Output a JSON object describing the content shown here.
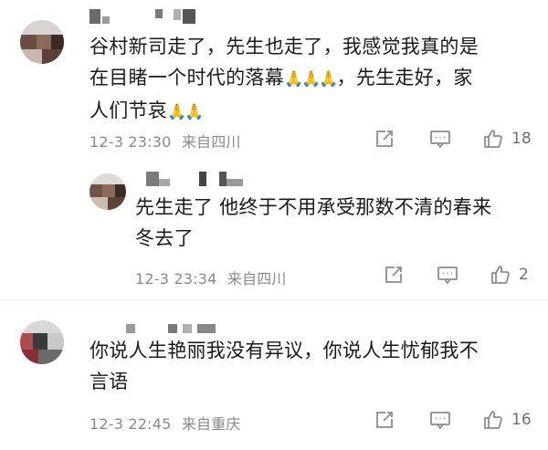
{
  "comments": [
    {
      "text_lines": [
        "谷村新司走了，先生也走了，我感觉我真的是",
        "在目睹一个时代的落幕",
        "，先生走好，家",
        "人们节哀"
      ],
      "emoji_mid": "🙏🙏🙏",
      "emoji_end": "🙏🙏",
      "timestamp": "12-3 23:30",
      "location": "来自四川",
      "like_count": "18"
    },
    {
      "text_lines": [
        "先生走了 他终于不用承受那数不清的春来",
        "冬去了"
      ],
      "timestamp": "12-3 23:34",
      "location": "来自四川",
      "like_count": "2"
    },
    {
      "text_lines": [
        "你说人生艳丽我没有异议，你说人生忧郁我不",
        "言语"
      ],
      "timestamp": "12-3 22:45",
      "location": "来自重庆",
      "like_count": "16"
    }
  ],
  "icons": {
    "share": "share-icon",
    "comment": "comment-icon",
    "like": "thumbs-up-icon"
  },
  "colors": {
    "text": "#1a1a1a",
    "meta": "#8a8a8a",
    "icon": "#8c8c8c",
    "divider": "#ececec"
  }
}
